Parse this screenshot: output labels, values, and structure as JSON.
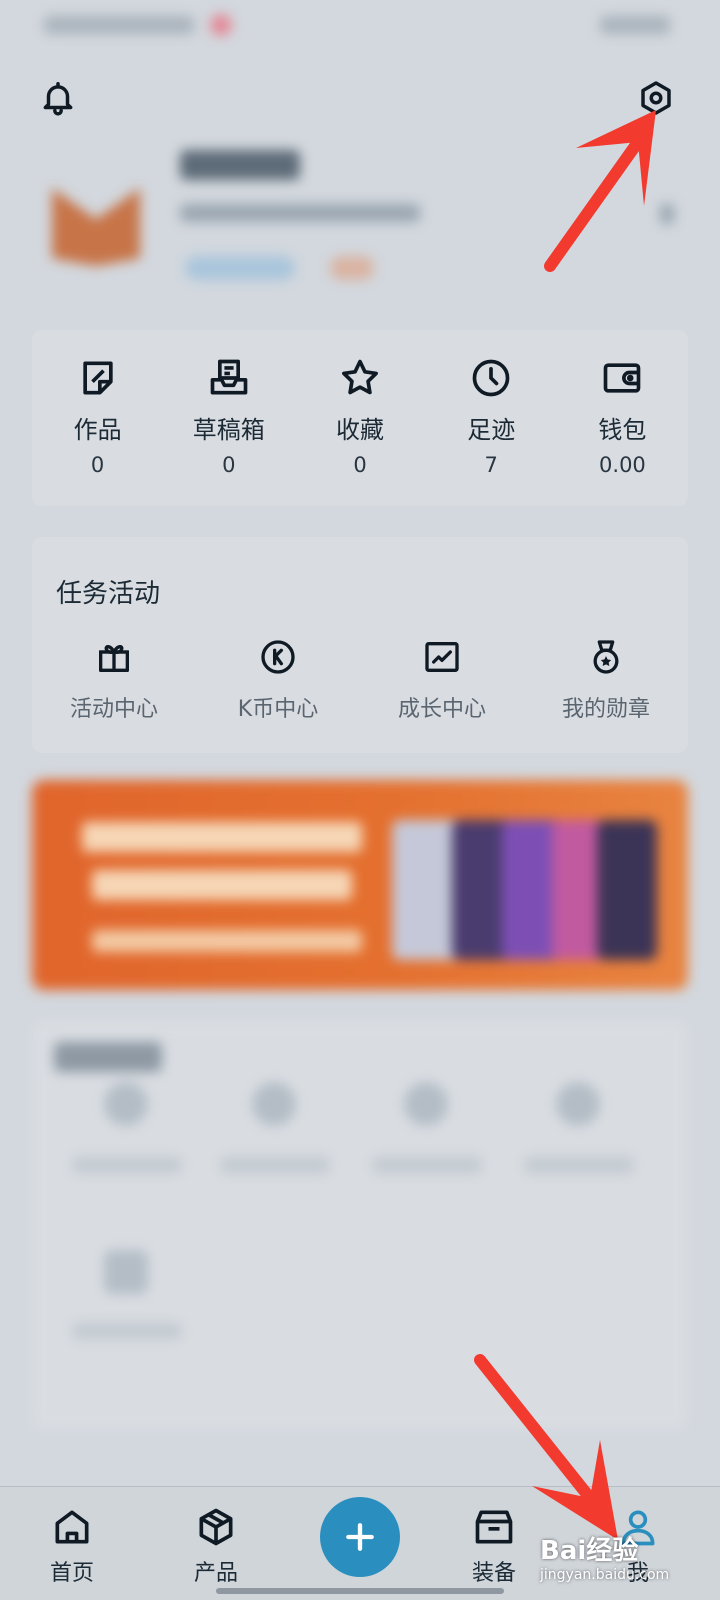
{
  "stats": [
    {
      "label": "作品",
      "value": "0",
      "icon": "edit-note-icon"
    },
    {
      "label": "草稿箱",
      "value": "0",
      "icon": "drafts-inbox-icon"
    },
    {
      "label": "收藏",
      "value": "0",
      "icon": "star-icon"
    },
    {
      "label": "足迹",
      "value": "7",
      "icon": "clock-icon"
    },
    {
      "label": "钱包",
      "value": "0.00",
      "icon": "wallet-icon"
    }
  ],
  "tasks": {
    "title": "任务活动",
    "items": [
      {
        "label": "活动中心",
        "icon": "gift-icon"
      },
      {
        "label": "K币中心",
        "icon": "k-coin-icon"
      },
      {
        "label": "成长中心",
        "icon": "growth-chart-icon"
      },
      {
        "label": "我的勋章",
        "icon": "medal-icon"
      }
    ]
  },
  "tabbar": {
    "items": [
      {
        "label": "首页",
        "icon": "home-icon"
      },
      {
        "label": "产品",
        "icon": "cube-icon"
      },
      {
        "label": "装备",
        "icon": "box-icon"
      },
      {
        "label": "我",
        "icon": "person-icon"
      }
    ],
    "fab_icon": "plus-icon"
  },
  "watermark": {
    "brand": "Bai经验",
    "url": "jingyan.baidu.com"
  },
  "colors": {
    "accent": "#2a8fbf",
    "annotation_arrow": "#f23a2f",
    "banner": "#e0652c"
  }
}
